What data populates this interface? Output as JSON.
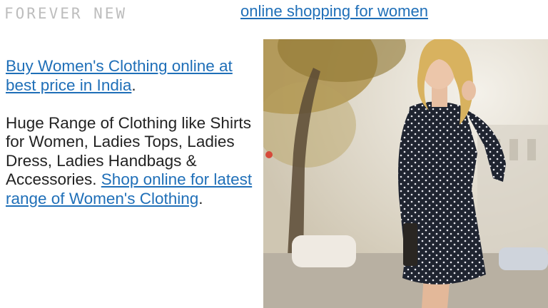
{
  "brand": {
    "logo_text": "FOREVER NEW"
  },
  "header": {
    "link_text": "online shopping for women"
  },
  "content": {
    "line1_link": "Buy Women's Clothing online at best price in India",
    "line1_tail": ".",
    "paragraph2_text": "Huge Range of Clothing like Shirts for Women, Ladies Tops, Ladies Dress, Ladies Handbags & Accessories. ",
    "paragraph2_link": "Shop online for latest range of Women's Clothing",
    "paragraph2_tail": "."
  },
  "image": {
    "description_icon": "woman-in-polka-dot-dress-photo"
  },
  "colors": {
    "link": "#1f6fb8",
    "text": "#222222",
    "logo": "#bdbdbd"
  }
}
